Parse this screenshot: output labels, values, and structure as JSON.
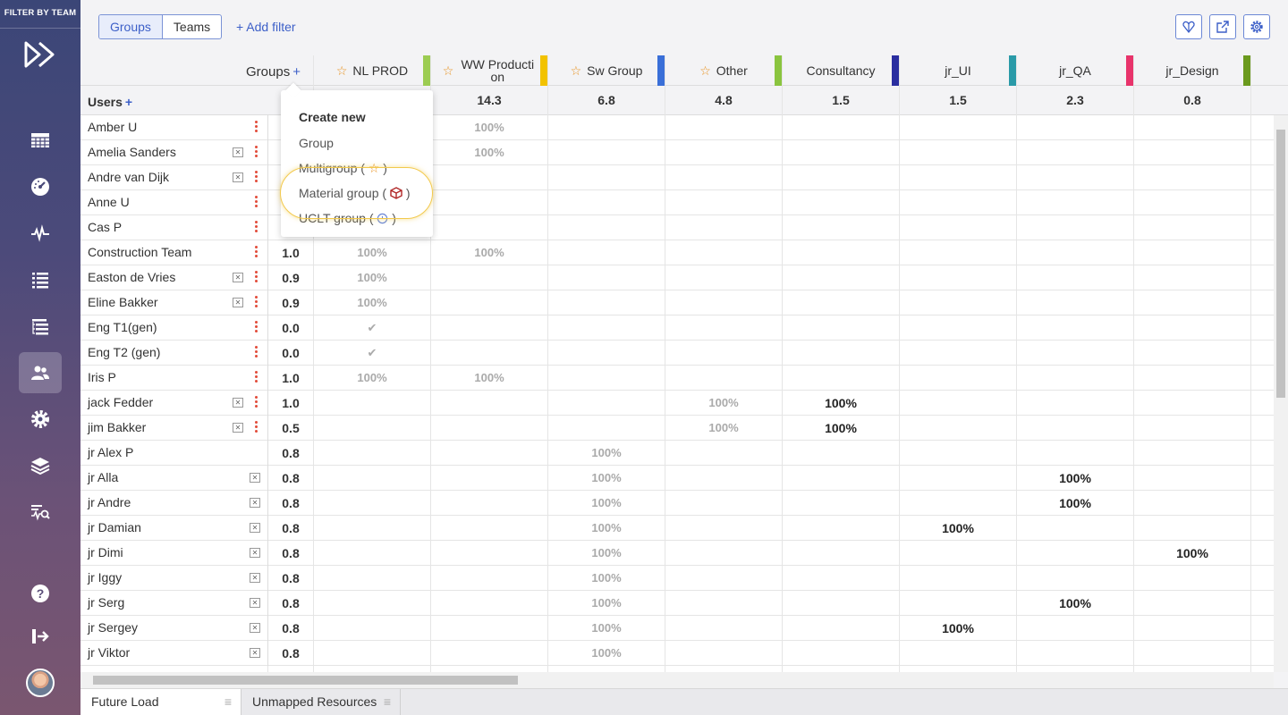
{
  "sidebar": {
    "title": "FILTER BY TEAM",
    "items": [
      {
        "icon": "calendar-grid-icon"
      },
      {
        "icon": "dashboard-gauge-icon"
      },
      {
        "icon": "activity-pulse-icon"
      },
      {
        "icon": "list-icon"
      },
      {
        "icon": "tree-list-icon"
      },
      {
        "icon": "users-icon",
        "active": true
      },
      {
        "icon": "gear-icon"
      },
      {
        "icon": "layers-icon"
      },
      {
        "icon": "analytics-search-icon"
      },
      {
        "icon": "help-icon"
      },
      {
        "icon": "logout-icon"
      }
    ]
  },
  "topbar": {
    "tabs": [
      "Groups",
      "Teams"
    ],
    "add_filter": "+ Add filter"
  },
  "grid": {
    "groups_label": "Groups",
    "groups_plus": "+",
    "users_label": "Users",
    "users_plus": "+",
    "columns": [
      {
        "name": "NL PROD",
        "star": true,
        "sum": "",
        "color": "#9ccc52"
      },
      {
        "name": "WW Production",
        "star": true,
        "sum": "14.3",
        "color": "#f2c200"
      },
      {
        "name": "Sw Group",
        "star": true,
        "sum": "6.8",
        "color": "#3a6fd8"
      },
      {
        "name": "Other",
        "star": true,
        "sum": "4.8",
        "color": "#8ac43f"
      },
      {
        "name": "Consultancy",
        "star": false,
        "sum": "1.5",
        "color": "#2a2ea0"
      },
      {
        "name": "jr_UI",
        "star": false,
        "sum": "1.5",
        "color": "#2a9aa8"
      },
      {
        "name": "jr_QA",
        "star": false,
        "sum": "2.3",
        "color": "#e8336b"
      },
      {
        "name": "jr_Design",
        "star": false,
        "sum": "0.8",
        "color": "#6b9a1e"
      }
    ],
    "rows": [
      {
        "name": "Amber U",
        "x": false,
        "dots": true,
        "cap": "",
        "cells": {
          "1": "100%"
        }
      },
      {
        "name": "Amelia Sanders",
        "x": true,
        "dots": true,
        "cap": "",
        "cells": {
          "1": "100%"
        }
      },
      {
        "name": "Andre van Dijk",
        "x": true,
        "dots": true,
        "cap": "",
        "cells": {}
      },
      {
        "name": "Anne U",
        "x": false,
        "dots": true,
        "cap": "",
        "cells": {}
      },
      {
        "name": "Cas P",
        "x": false,
        "dots": true,
        "cap": "",
        "cells": {}
      },
      {
        "name": "Construction Team",
        "x": false,
        "dots": true,
        "cap": "1.0",
        "cells": {
          "0": "100%",
          "1": "100%"
        }
      },
      {
        "name": "Easton de Vries",
        "x": true,
        "dots": true,
        "cap": "0.9",
        "cells": {
          "0": "100%"
        }
      },
      {
        "name": "Eline Bakker",
        "x": true,
        "dots": true,
        "cap": "0.9",
        "cells": {
          "0": "100%"
        }
      },
      {
        "name": "Eng T1(gen)",
        "x": false,
        "dots": true,
        "cap": "0.0",
        "cells": {
          "0": "✔"
        }
      },
      {
        "name": "Eng T2 (gen)",
        "x": false,
        "dots": true,
        "cap": "0.0",
        "cells": {
          "0": "✔"
        }
      },
      {
        "name": "Iris P",
        "x": false,
        "dots": true,
        "cap": "1.0",
        "cells": {
          "0": "100%",
          "1": "100%"
        }
      },
      {
        "name": "jack Fedder",
        "x": true,
        "dots": true,
        "cap": "1.0",
        "cells": {
          "3": "100%"
        },
        "strong": {
          "4": "100%"
        }
      },
      {
        "name": "jim Bakker",
        "x": true,
        "dots": true,
        "cap": "0.5",
        "cells": {
          "3": "100%"
        },
        "strong": {
          "4": "100%"
        }
      },
      {
        "name": "jr Alex P",
        "x": false,
        "dots": false,
        "cap": "0.8",
        "cells": {
          "2": "100%"
        }
      },
      {
        "name": "jr Alla",
        "x": true,
        "dots": false,
        "cap": "0.8",
        "cells": {
          "2": "100%"
        },
        "strong": {
          "6": "100%"
        }
      },
      {
        "name": "jr Andre",
        "x": true,
        "dots": false,
        "cap": "0.8",
        "cells": {
          "2": "100%"
        },
        "strong": {
          "6": "100%"
        }
      },
      {
        "name": "jr Damian",
        "x": true,
        "dots": false,
        "cap": "0.8",
        "cells": {
          "2": "100%"
        },
        "strong": {
          "5": "100%"
        }
      },
      {
        "name": "jr Dimi",
        "x": true,
        "dots": false,
        "cap": "0.8",
        "cells": {
          "2": "100%"
        },
        "strong": {
          "7": "100%"
        }
      },
      {
        "name": "jr Iggy",
        "x": true,
        "dots": false,
        "cap": "0.8",
        "cells": {
          "2": "100%"
        }
      },
      {
        "name": "jr Serg",
        "x": true,
        "dots": false,
        "cap": "0.8",
        "cells": {
          "2": "100%"
        },
        "strong": {
          "6": "100%"
        }
      },
      {
        "name": "jr Sergey",
        "x": true,
        "dots": false,
        "cap": "0.8",
        "cells": {
          "2": "100%"
        },
        "strong": {
          "5": "100%"
        }
      },
      {
        "name": "jr Viktor",
        "x": true,
        "dots": false,
        "cap": "0.8",
        "cells": {
          "2": "100%"
        }
      }
    ]
  },
  "dropdown": {
    "title": "Create new",
    "group": "Group",
    "multigroup": "Multigroup (",
    "material": "Material group (",
    "uclt": "UCLT group (",
    "close_paren": ")"
  },
  "bottom_tabs": [
    "Future Load",
    "Unmapped Resources"
  ],
  "colors": {
    "accent": "#3c5fc8",
    "dots": "#e24b3a",
    "star": "#e8901c",
    "highlight": "#f2c94c"
  }
}
